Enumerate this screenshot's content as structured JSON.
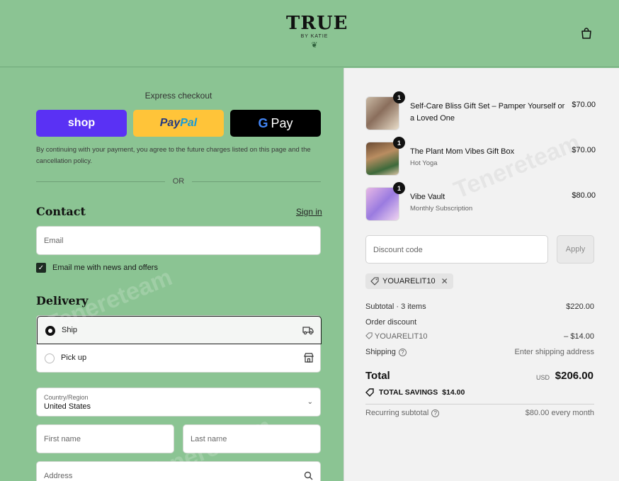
{
  "header": {
    "logo_main": "TRUE",
    "logo_sub": "BY KATIE",
    "cart_icon": "shopping-bag-icon"
  },
  "express": {
    "title": "Express checkout",
    "shop_label": "shop",
    "paypal_label_1": "Pay",
    "paypal_label_2": "Pal",
    "gpay_g": "G",
    "gpay_label": "Pay",
    "consent": "By continuing with your payment, you agree to the future charges listed on this page and the cancellation policy.",
    "or": "OR"
  },
  "contact": {
    "heading": "Contact",
    "signin": "Sign in",
    "email_placeholder": "Email",
    "newsletter_label": "Email me with news and offers",
    "newsletter_checked": true
  },
  "delivery": {
    "heading": "Delivery",
    "options": [
      {
        "label": "Ship",
        "icon": "truck-icon",
        "selected": true
      },
      {
        "label": "Pick up",
        "icon": "store-icon",
        "selected": false
      }
    ],
    "country_caption": "Country/Region",
    "country_value": "United States",
    "first_name_placeholder": "First name",
    "last_name_placeholder": "Last name",
    "address_placeholder": "Address"
  },
  "order": {
    "items": [
      {
        "name": "Self-Care Bliss Gift Set – Pamper Yourself or a Loved One",
        "sub": "",
        "price": "$70.00",
        "qty": "1"
      },
      {
        "name": "The Plant Mom Vibes Gift Box",
        "sub": "Hot Yoga",
        "price": "$70.00",
        "qty": "1"
      },
      {
        "name": "Vibe Vault",
        "sub": "Monthly Subscription",
        "price": "$80.00",
        "qty": "1"
      }
    ],
    "discount_placeholder": "Discount code",
    "apply_label": "Apply",
    "applied_code": "YOUARELIT10",
    "subtotal_label": "Subtotal · 3 items",
    "subtotal_value": "$220.00",
    "order_discount_label": "Order discount",
    "discount_code_label": "YOUARELIT10",
    "discount_value": "– $14.00",
    "shipping_label": "Shipping",
    "shipping_value": "Enter shipping address",
    "total_label": "Total",
    "total_currency": "USD",
    "total_value": "$206.00",
    "savings_label": "TOTAL SAVINGS",
    "savings_value": "$14.00",
    "recurring_label": "Recurring subtotal",
    "recurring_value": "$80.00 every month"
  },
  "watermark": "Tenereteam",
  "colors": {
    "page_green": "#8bc493",
    "summary_bg": "#f2f2f2",
    "shop_purple": "#5a31f4",
    "paypal_yellow": "#ffc439"
  }
}
